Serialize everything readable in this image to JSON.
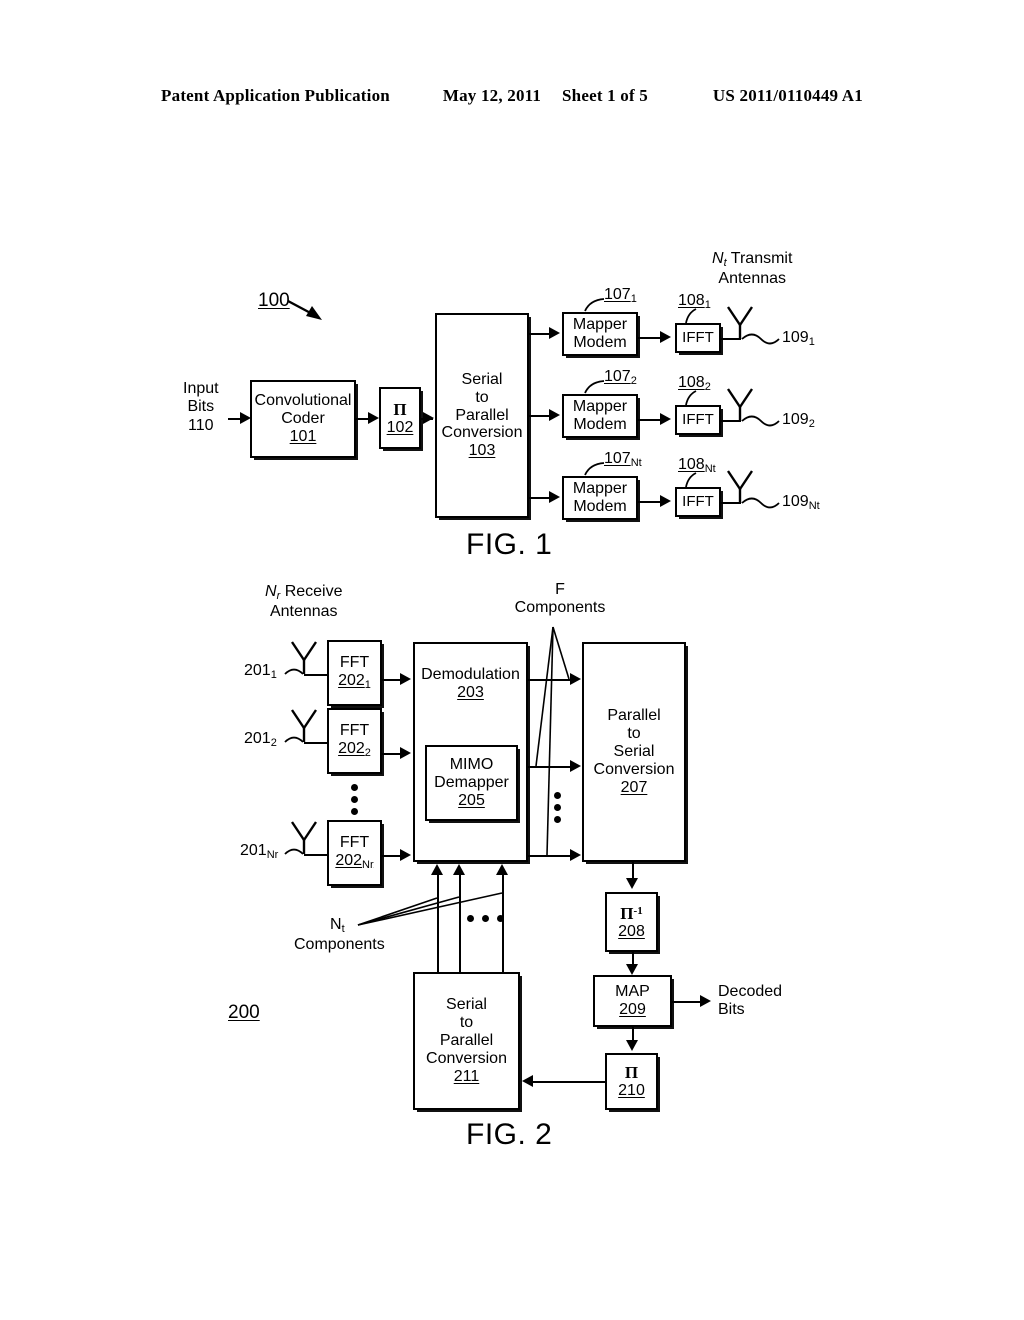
{
  "header": {
    "publication": "Patent Application Publication",
    "date": "May 12, 2011",
    "sheet": "Sheet 1 of 5",
    "patent_number": "US 2011/0110449 A1"
  },
  "figure1": {
    "caption": "FIG. 1",
    "system_ref": "100",
    "input_label_line1": "Input",
    "input_label_line2": "Bits",
    "input_label_line3": "110",
    "coder": {
      "line1": "Convolutional",
      "line2": "Coder",
      "ref": "101"
    },
    "interleaver": {
      "symbol": "Π",
      "ref": "102"
    },
    "serial_to_parallel": {
      "line1": "Serial",
      "line2": "to",
      "line3": "Parallel",
      "line4": "Conversion",
      "ref": "103"
    },
    "antennas_label_line1": "Transmit",
    "antennas_label_line2": "Antennas",
    "antennas_label_prefix": "N",
    "antennas_label_sub": "t",
    "chains": [
      {
        "mapper_line1": "Mapper",
        "mapper_line2": "Modem",
        "mapper_ref": "107",
        "mapper_sub": "1",
        "ifft_label": "IFFT",
        "ifft_ref": "108",
        "ifft_sub": "1",
        "antenna_ref": "109",
        "antenna_sub": "1"
      },
      {
        "mapper_line1": "Mapper",
        "mapper_line2": "Modem",
        "mapper_ref": "107",
        "mapper_sub": "2",
        "ifft_label": "IFFT",
        "ifft_ref": "108",
        "ifft_sub": "2",
        "antenna_ref": "109",
        "antenna_sub": "2"
      },
      {
        "mapper_line1": "Mapper",
        "mapper_line2": "Modem",
        "mapper_ref": "107",
        "mapper_sub": "Nt",
        "ifft_label": "IFFT",
        "ifft_ref": "108",
        "ifft_sub": "Nt",
        "antenna_ref": "109",
        "antenna_sub": "Nt"
      }
    ]
  },
  "figure2": {
    "caption": "FIG. 2",
    "system_ref": "200",
    "receive_label_prefix": "N",
    "receive_label_sub": "r",
    "receive_label_line1": "Receive",
    "receive_label_line2": "Antennas",
    "f_components_line1": "F",
    "f_components_line2": "Components",
    "nt_components_prefix": "N",
    "nt_components_sub": "t",
    "nt_components_line2": "Components",
    "chains": [
      {
        "antenna_ref": "201",
        "antenna_sub": "1",
        "fft_label": "FFT",
        "fft_ref": "202",
        "fft_sub": "1"
      },
      {
        "antenna_ref": "201",
        "antenna_sub": "2",
        "fft_label": "FFT",
        "fft_ref": "202",
        "fft_sub": "2"
      },
      {
        "antenna_ref": "201",
        "antenna_sub": "Nr",
        "fft_label": "FFT",
        "fft_ref": "202",
        "fft_sub": "Nr"
      }
    ],
    "demodulation": {
      "label": "Demodulation",
      "ref": "203"
    },
    "mimo_demapper": {
      "line1": "MIMO",
      "line2": "Demapper",
      "ref": "205"
    },
    "parallel_to_serial": {
      "line1": "Parallel",
      "line2": "to",
      "line3": "Serial",
      "line4": "Conversion",
      "ref": "207"
    },
    "deinterleaver": {
      "symbol": "Π",
      "superscript": "-1",
      "ref": "208"
    },
    "map": {
      "label": "MAP",
      "ref": "209"
    },
    "interleaver": {
      "symbol": "Π",
      "ref": "210"
    },
    "serial_to_parallel": {
      "line1": "Serial",
      "line2": "to",
      "line3": "Parallel",
      "line4": "Conversion",
      "ref": "211"
    },
    "decoded_line1": "Decoded",
    "decoded_line2": "Bits"
  },
  "colors": {
    "ink": "#000000",
    "paper": "#ffffff"
  }
}
